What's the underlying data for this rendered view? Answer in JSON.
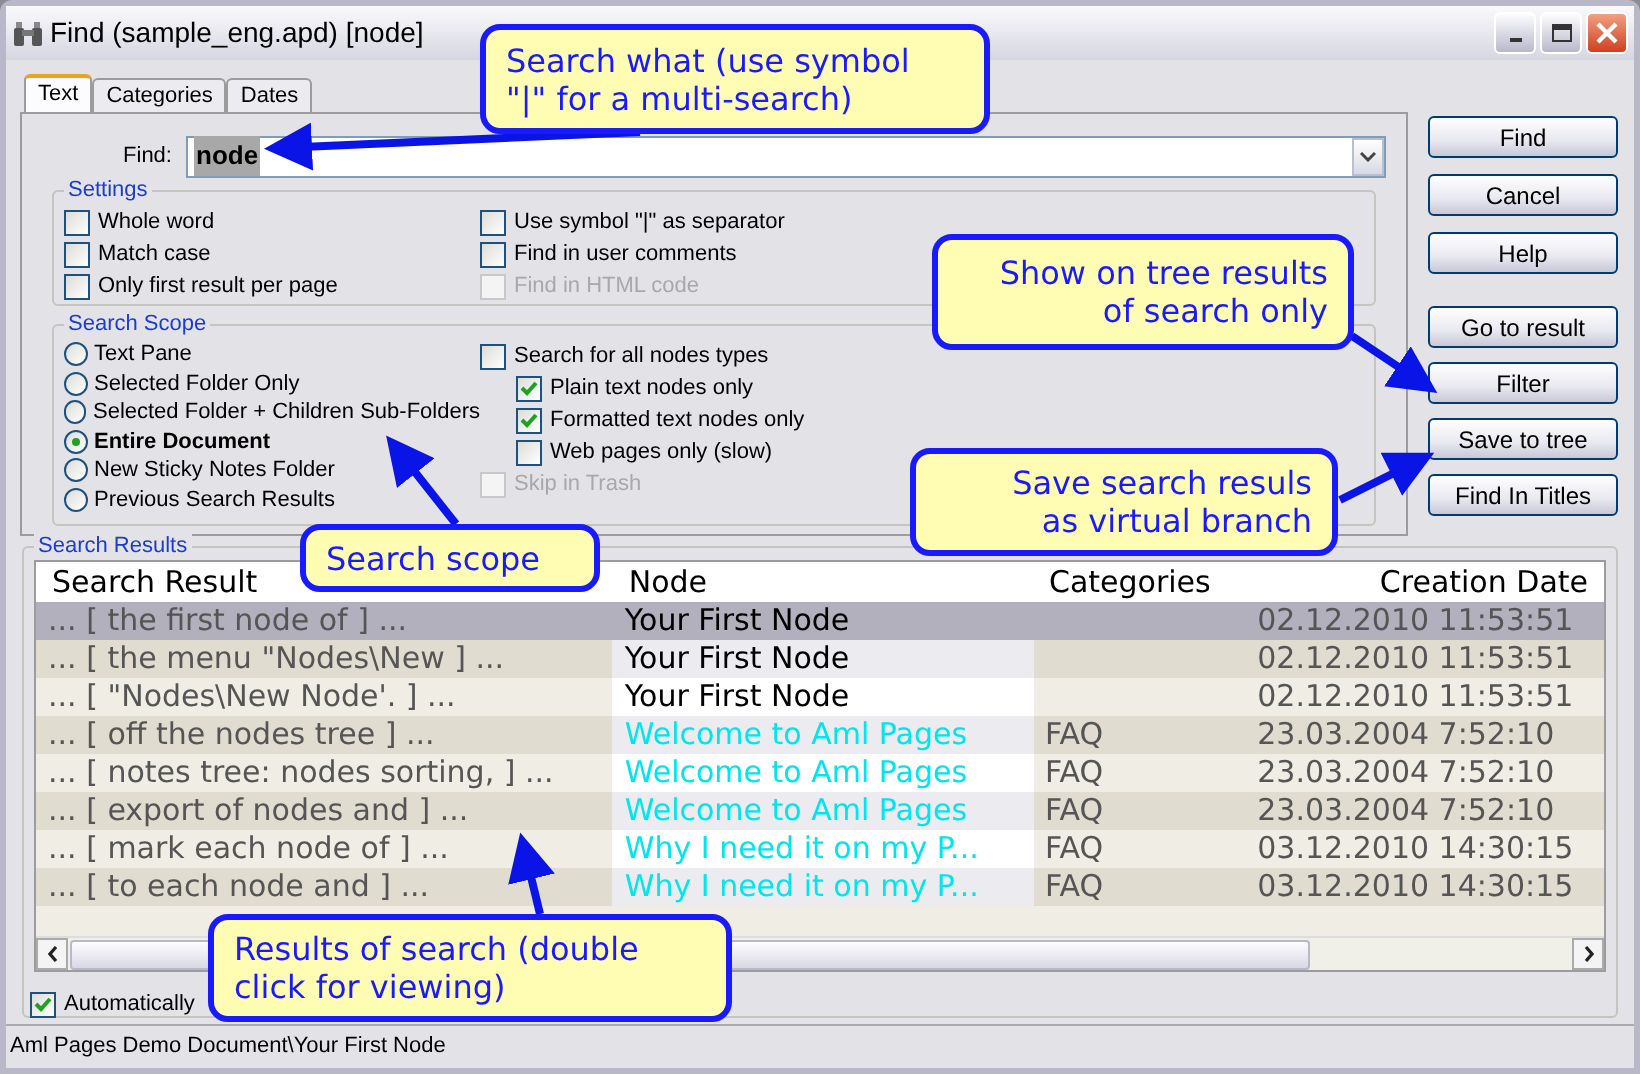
{
  "window": {
    "title": "Find (sample_eng.apd) [node]"
  },
  "tabs": [
    {
      "label": "Text",
      "selected": true
    },
    {
      "label": "Categories",
      "selected": false
    },
    {
      "label": "Dates",
      "selected": false
    }
  ],
  "find": {
    "label": "Find:",
    "value": "node"
  },
  "settings": {
    "title": "Settings",
    "left": [
      {
        "label": "Whole word",
        "checked": false,
        "disabled": false
      },
      {
        "label": "Match case",
        "checked": false,
        "disabled": false
      },
      {
        "label": "Only first result per page",
        "checked": false,
        "disabled": false
      }
    ],
    "right": [
      {
        "label": "Use symbol \"|\" as separator",
        "checked": false,
        "disabled": false
      },
      {
        "label": "Find in user comments",
        "checked": false,
        "disabled": false
      },
      {
        "label": "Find in HTML code",
        "checked": false,
        "disabled": true
      }
    ]
  },
  "scope": {
    "title": "Search Scope",
    "options": [
      {
        "label": "Text Pane",
        "selected": false
      },
      {
        "label": "Selected Folder Only",
        "selected": false
      },
      {
        "label": "Selected Folder + Children Sub-Folders",
        "selected": false
      },
      {
        "label": "Entire Document",
        "selected": true
      },
      {
        "label": "New Sticky Notes Folder",
        "selected": false
      },
      {
        "label": "Previous Search Results",
        "selected": false
      }
    ],
    "all_types": {
      "label": "Search for all nodes types",
      "checked": false,
      "disabled": false
    },
    "types": [
      {
        "label": "Plain text nodes only",
        "checked": true,
        "disabled": false
      },
      {
        "label": "Formatted text nodes only",
        "checked": true,
        "disabled": false
      },
      {
        "label": "Web pages only (slow)",
        "checked": false,
        "disabled": false
      }
    ],
    "skip_trash": {
      "label": "Skip in Trash",
      "checked": false,
      "disabled": true
    }
  },
  "buttons_top": [
    "Find",
    "Cancel",
    "Help"
  ],
  "buttons_bottom": [
    "Go to result",
    "Filter",
    "Save to tree",
    "Find In Titles"
  ],
  "results": {
    "title": "Search Results",
    "columns": [
      "Search Result",
      "Node",
      "Categories",
      "Creation Date"
    ],
    "rows": [
      {
        "result": "... [ the first node of ] ...",
        "node": "Your First Node",
        "color": "#000000",
        "category": "",
        "date": "02.12.2010 11:53:51",
        "selected": true
      },
      {
        "result": "... [ the menu \"Nodes\\New ] ...",
        "node": "Your First Node",
        "color": "#000000",
        "category": "",
        "date": "02.12.2010 11:53:51",
        "selected": false
      },
      {
        "result": "... [ \"Nodes\\New Node'. ] ...",
        "node": "Your First Node",
        "color": "#000000",
        "category": "",
        "date": "02.12.2010 11:53:51",
        "selected": false
      },
      {
        "result": "... [ off the nodes tree ] ...",
        "node": "Welcome to Aml Pages",
        "color": "#00e5ee",
        "category": "FAQ",
        "date": "23.03.2004 7:52:10",
        "selected": false
      },
      {
        "result": "... [ notes tree: nodes sorting, ] ...",
        "node": "Welcome to Aml Pages",
        "color": "#00e5ee",
        "category": "FAQ",
        "date": "23.03.2004 7:52:10",
        "selected": false
      },
      {
        "result": "... [ export of nodes and ] ...",
        "node": "Welcome to Aml Pages",
        "color": "#00e5ee",
        "category": "FAQ",
        "date": "23.03.2004 7:52:10",
        "selected": false
      },
      {
        "result": "... [ mark each node of ] ...",
        "node": "Why I need it on my P...",
        "color": "#00e5ee",
        "category": "FAQ",
        "date": "03.12.2010 14:30:15",
        "selected": false
      },
      {
        "result": "... [ to each node and ] ...",
        "node": "Why I need it on my P...",
        "color": "#00e5ee",
        "category": "FAQ",
        "date": "03.12.2010 14:30:15",
        "selected": false
      }
    ]
  },
  "auto_scroll": {
    "label": "Automatically",
    "checked": true,
    "disabled": false
  },
  "status_bar": "Aml Pages Demo Document\\Your First Node",
  "callouts": [
    {
      "text": "Search what (use symbol\n\"|\" for a multi-search)",
      "kind": "left"
    },
    {
      "text": "Show on tree results\nof search only",
      "kind": "right"
    },
    {
      "text": "Search scope",
      "kind": "left"
    },
    {
      "text": "Save search resuls\nas virtual branch",
      "kind": "right"
    },
    {
      "text": "Results of search (double\nclick for viewing)",
      "kind": "left"
    }
  ]
}
